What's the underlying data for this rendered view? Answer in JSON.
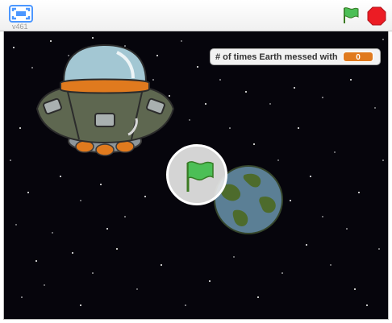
{
  "toolbar": {
    "version": "v461",
    "icons": {
      "fullscreen": "fullscreen-icon",
      "green_flag": "green-flag-icon",
      "stop": "stop-icon"
    }
  },
  "stage": {
    "background_color": "#06050c",
    "monitor": {
      "label": "# of times Earth messed with",
      "value": "0",
      "value_color": "#e07a1e"
    },
    "sprites": [
      "ufo",
      "earth"
    ],
    "overlay_icon": "green-flag-icon"
  }
}
